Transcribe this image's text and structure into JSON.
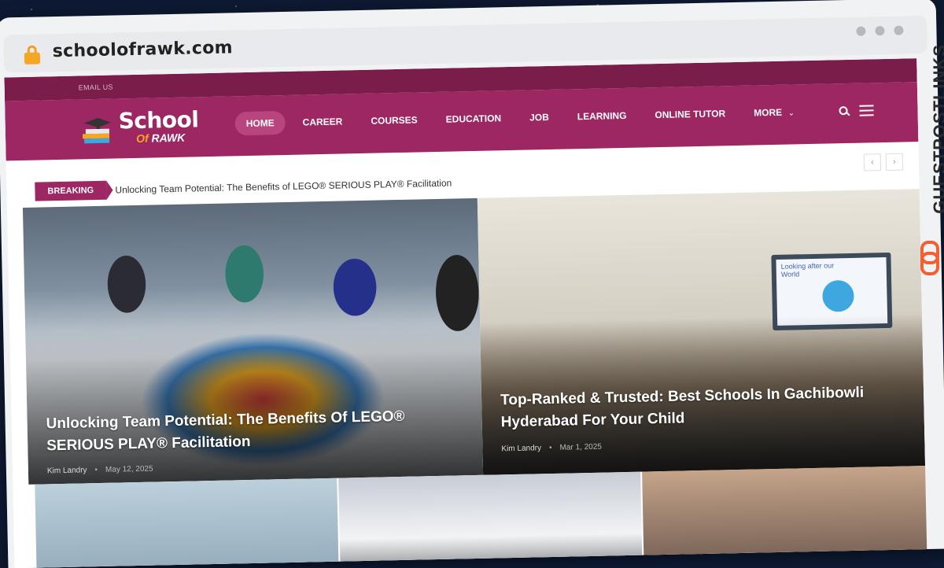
{
  "browser": {
    "url": "schoolofrawk.com"
  },
  "site": {
    "top_link": "EMAIL US",
    "logo": {
      "line1": "School",
      "line2a": "Of",
      "line2b": "RAWK"
    },
    "nav": [
      {
        "label": "HOME",
        "active": true
      },
      {
        "label": "CAREER"
      },
      {
        "label": "COURSES"
      },
      {
        "label": "EDUCATION"
      },
      {
        "label": "JOB"
      },
      {
        "label": "LEARNING"
      },
      {
        "label": "ONLINE TUTOR"
      },
      {
        "label": "MORE"
      }
    ],
    "icons": [
      "search-icon",
      "hamburger-menu-icon",
      "chevron-down-icon"
    ],
    "breaking": {
      "tag": "BREAKING",
      "headline": "Unlocking Team Potential: The Benefits of LEGO® SERIOUS PLAY® Facilitation",
      "prev": "‹",
      "next": "›"
    },
    "posts": [
      {
        "title": "Unlocking Team Potential: The Benefits Of LEGO® SERIOUS PLAY® Facilitation",
        "author": "Kim Landry",
        "date": "May 12, 2025"
      },
      {
        "title": "Top-Ranked & Trusted: Best Schools In Gachibowli Hyderabad For Your Child",
        "author": "Kim Landry",
        "date": "Mar 1, 2025"
      }
    ],
    "whiteboard_text": "Looking after our World"
  },
  "watermark": "GUESTPOSTLINKS",
  "colors": {
    "brand": "#9c2762",
    "brand_dark": "#7a1d4a",
    "accent": "#f5a623",
    "watermark_icon": "#f06030"
  }
}
